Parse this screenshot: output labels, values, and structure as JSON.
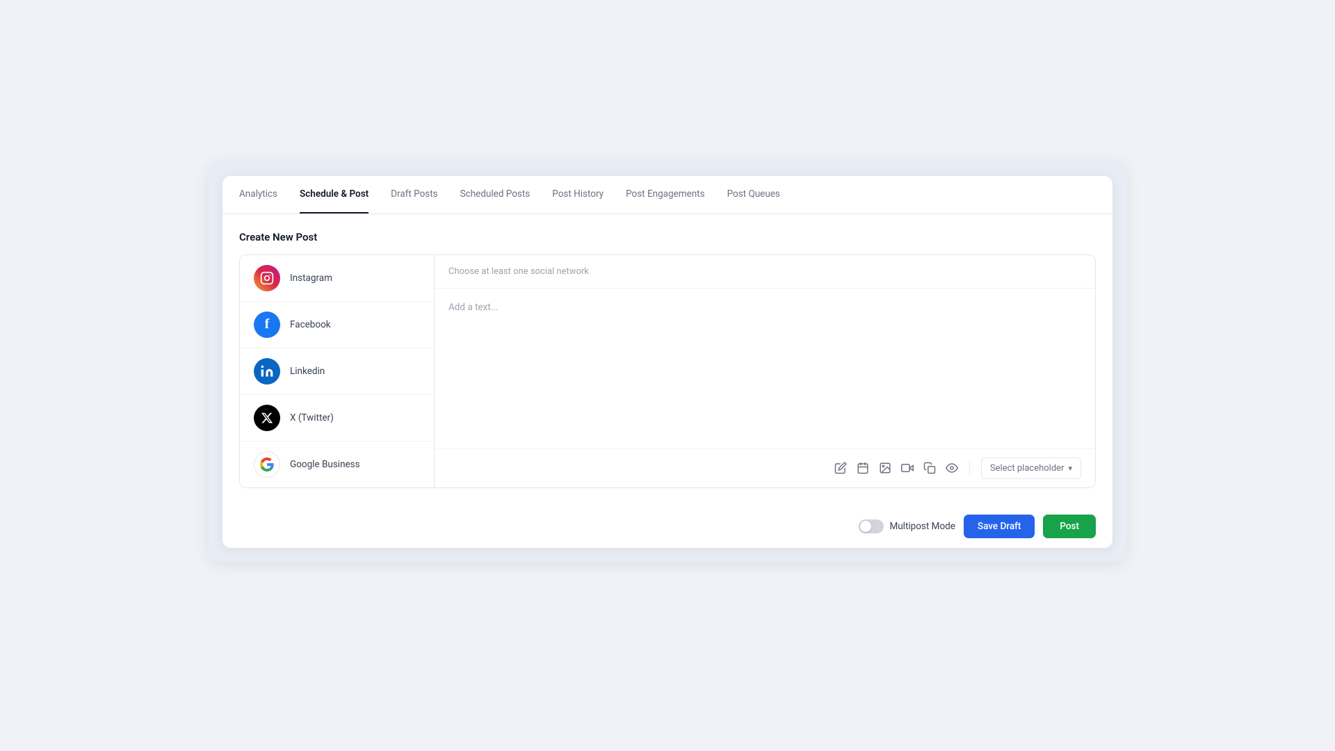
{
  "nav": {
    "tabs": [
      {
        "id": "analytics",
        "label": "Analytics",
        "active": false
      },
      {
        "id": "schedule-post",
        "label": "Schedule & Post",
        "active": true
      },
      {
        "id": "draft-posts",
        "label": "Draft Posts",
        "active": false
      },
      {
        "id": "scheduled-posts",
        "label": "Scheduled Posts",
        "active": false
      },
      {
        "id": "post-history",
        "label": "Post History",
        "active": false
      },
      {
        "id": "post-engagements",
        "label": "Post Engagements",
        "active": false
      },
      {
        "id": "post-queues",
        "label": "Post Queues",
        "active": false
      }
    ]
  },
  "section": {
    "title": "Create New Post"
  },
  "social_networks": [
    {
      "id": "instagram",
      "name": "Instagram",
      "type": "instagram"
    },
    {
      "id": "facebook",
      "name": "Facebook",
      "type": "facebook"
    },
    {
      "id": "linkedin",
      "name": "Linkedin",
      "type": "linkedin"
    },
    {
      "id": "twitter",
      "name": "X (Twitter)",
      "type": "twitter"
    },
    {
      "id": "google",
      "name": "Google Business",
      "type": "google"
    }
  ],
  "editor": {
    "network_hint": "Choose at least one social network",
    "text_placeholder": "Add a text...",
    "placeholder_select_label": "Select placeholder"
  },
  "bottom_bar": {
    "multipost_label": "Multipost Mode",
    "save_draft_label": "Save Draft",
    "post_label": "Post"
  }
}
